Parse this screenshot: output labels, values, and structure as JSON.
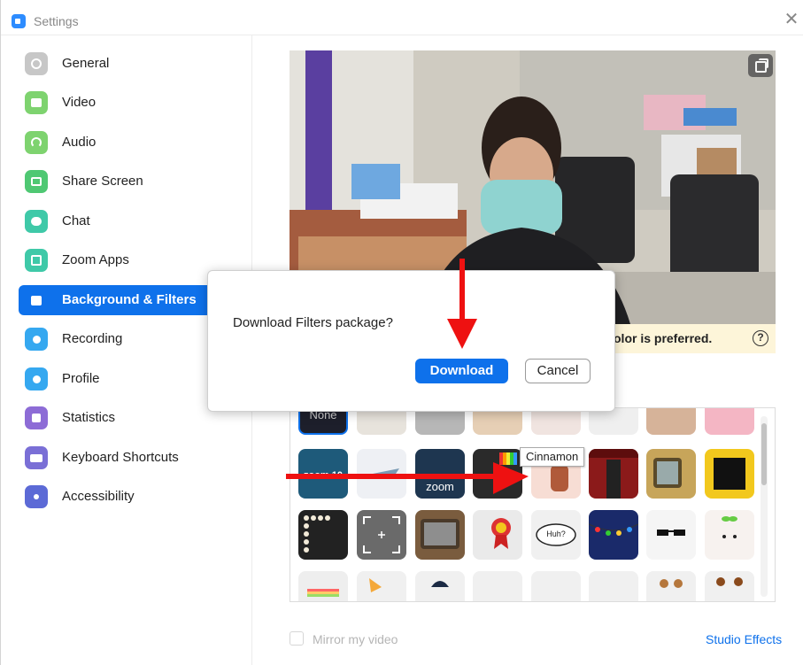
{
  "window": {
    "title": "Settings",
    "close_glyph": "✕"
  },
  "sidebar": {
    "items": [
      {
        "label": "General",
        "icon": "gear-icon",
        "color": "#c7c7c7"
      },
      {
        "label": "Video",
        "icon": "video-camera-icon",
        "color": "#7ed36f"
      },
      {
        "label": "Audio",
        "icon": "headphones-icon",
        "color": "#7ed36f"
      },
      {
        "label": "Share Screen",
        "icon": "share-screen-icon",
        "color": "#4fc873"
      },
      {
        "label": "Chat",
        "icon": "chat-bubble-icon",
        "color": "#3fc9a8"
      },
      {
        "label": "Zoom Apps",
        "icon": "apps-icon",
        "color": "#3fc9a8"
      },
      {
        "label": "Background & Filters",
        "icon": "background-icon",
        "color": "#0e71eb",
        "active": true
      },
      {
        "label": "Recording",
        "icon": "record-icon",
        "color": "#35a8f0"
      },
      {
        "label": "Profile",
        "icon": "profile-icon",
        "color": "#35a8f0"
      },
      {
        "label": "Statistics",
        "icon": "statistics-icon",
        "color": "#8d6cd6"
      },
      {
        "label": "Keyboard Shortcuts",
        "icon": "keyboard-icon",
        "color": "#7a6fd6"
      },
      {
        "label": "Accessibility",
        "icon": "accessibility-icon",
        "color": "#5c6ad6"
      }
    ]
  },
  "preview": {
    "notice_text": "olor is preferred.",
    "help_glyph": "?"
  },
  "filters": {
    "tooltip": "Cinnamon",
    "row0_first_label": "None",
    "row1": [
      {
        "name": "zoom-10-badge",
        "text": "zoom 10"
      },
      {
        "name": "airplane-filter",
        "text": ""
      },
      {
        "name": "zoom-10-frame",
        "text": "zoom"
      },
      {
        "name": "tv-color-bars",
        "text": ""
      },
      {
        "name": "cinnamon-filter",
        "text": ""
      },
      {
        "name": "theater-curtain",
        "text": ""
      },
      {
        "name": "retro-tv",
        "text": ""
      },
      {
        "name": "emoji-frame",
        "text": ""
      }
    ],
    "row2": [
      {
        "name": "film-strip-frame",
        "text": ""
      },
      {
        "name": "camera-focus-frame",
        "text": ""
      },
      {
        "name": "old-tv-frame",
        "text": ""
      },
      {
        "name": "medal-filter",
        "text": ""
      },
      {
        "name": "speech-bubble-filter",
        "text": "Huh?"
      },
      {
        "name": "holiday-lights",
        "text": ""
      },
      {
        "name": "sunglasses-filter",
        "text": ""
      },
      {
        "name": "sprout-cute-face",
        "text": ""
      }
    ]
  },
  "dialog": {
    "message": "Download Filters package?",
    "download_label": "Download",
    "cancel_label": "Cancel"
  },
  "bottom": {
    "mirror_label": "Mirror my video",
    "studio_effects_label": "Studio Effects"
  }
}
